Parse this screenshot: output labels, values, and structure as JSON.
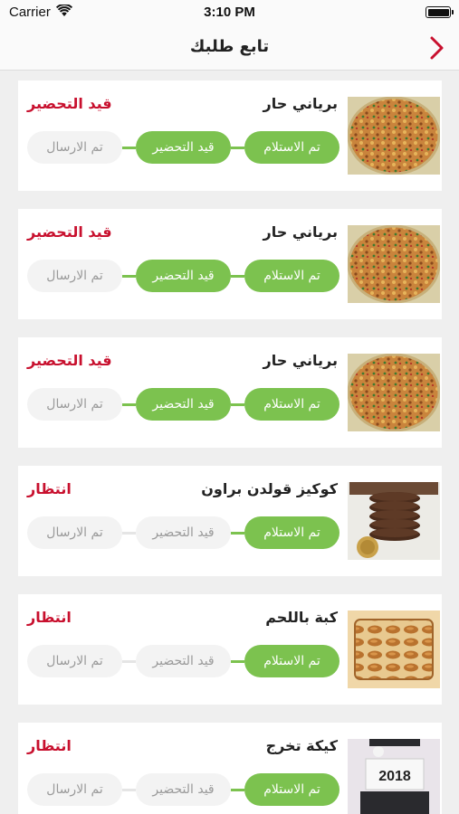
{
  "status_bar": {
    "carrier": "Carrier",
    "time": "3:10 PM"
  },
  "header": {
    "title": "تابع طلبك",
    "back_icon": "chevron-right-icon"
  },
  "colors": {
    "accent_red": "#c8102e",
    "step_done_green": "#7cc24f",
    "step_pending_gray": "#f3f3f3"
  },
  "steps_labels": [
    "تم الاستلام",
    "قيد التحضير",
    "تم الارسال"
  ],
  "orders": [
    {
      "name": "برياني حار",
      "status": "قيد التحضير",
      "image": "biryani-photo",
      "completed_steps": 2
    },
    {
      "name": "برياني حار",
      "status": "قيد التحضير",
      "image": "biryani-photo",
      "completed_steps": 2
    },
    {
      "name": "برياني حار",
      "status": "قيد التحضير",
      "image": "biryani-photo",
      "completed_steps": 2
    },
    {
      "name": "كوكيز قولدن براون",
      "status": "انتظار",
      "image": "cookies-photo",
      "completed_steps": 1
    },
    {
      "name": "كبة باللحم",
      "status": "انتظار",
      "image": "kibbeh-photo",
      "completed_steps": 1
    },
    {
      "name": "كيكة تخرج",
      "status": "انتظار",
      "image": "graduation-cake-photo",
      "completed_steps": 1,
      "image_text": "2018"
    }
  ]
}
